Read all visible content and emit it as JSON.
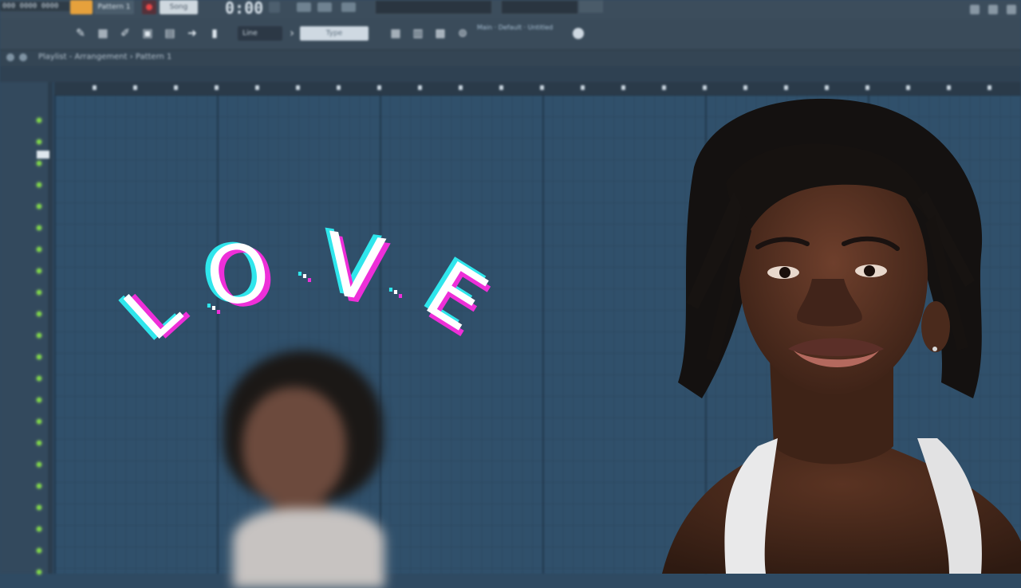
{
  "window": {
    "hint_text": "000 0000 0000",
    "pattern_label": "Pattern 1",
    "mode_label": "Song",
    "time": "0:00",
    "time_suffix": "00"
  },
  "toolbar": {
    "snap_value": "Line",
    "type_field": "Type",
    "hint_text": "Main · Default · Untitled"
  },
  "playlist": {
    "breadcrumb": "Playlist - Arrangement › Pattern 1",
    "track_count": 22
  },
  "overlay": {
    "title_letters": [
      "L",
      ".",
      "O",
      ".",
      "V",
      ".",
      "E"
    ],
    "glitch_colors": {
      "cyan": "#2fe6ec",
      "magenta": "#ee2fd8",
      "main": "#ffffff"
    }
  },
  "colors": {
    "grid_bg": "#30506b",
    "led_green": "#7ed44a",
    "toolbar_bg": "#3a4b5a"
  }
}
